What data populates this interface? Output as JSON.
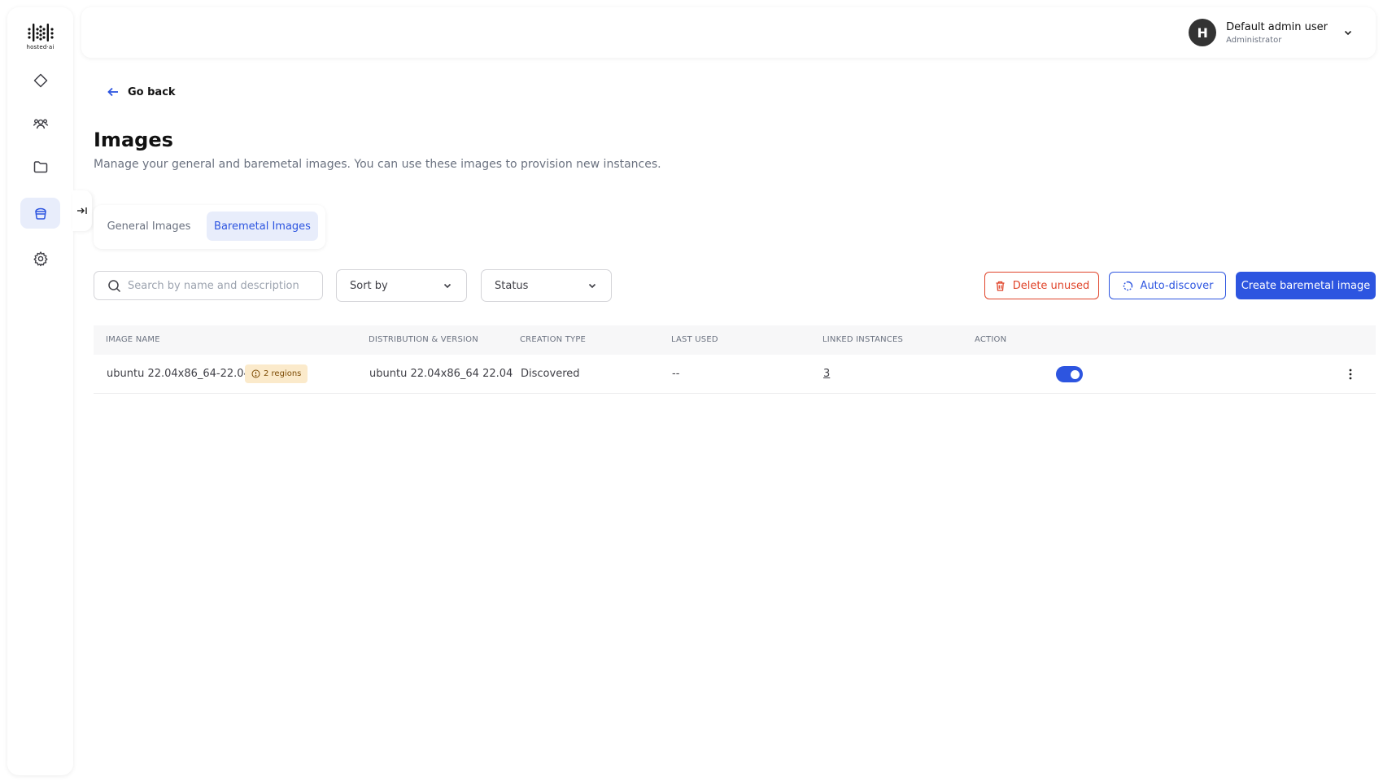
{
  "app": {
    "logo_text": "hosted·ai"
  },
  "sidebar": {
    "items": [
      {
        "icon": "diamond-icon"
      },
      {
        "icon": "team-icon"
      },
      {
        "icon": "folder-icon"
      },
      {
        "icon": "images-icon",
        "active": true
      },
      {
        "icon": "gear-icon"
      }
    ],
    "collapse_icon": "collapse-arrow-icon"
  },
  "header": {
    "user": {
      "initial": "H",
      "name": "Default admin user",
      "role": "Administrator"
    }
  },
  "page": {
    "go_back": "Go back",
    "title": "Images",
    "subtitle": "Manage your general and baremetal images. You can use these images to provision new instances."
  },
  "tabs": [
    {
      "label": "General Images",
      "active": false
    },
    {
      "label": "Baremetal Images",
      "active": true
    }
  ],
  "filters": {
    "search_placeholder": "Search by name and description",
    "sort_label": "Sort by",
    "status_label": "Status"
  },
  "actions": {
    "delete_unused": "Delete unused",
    "auto_discover": "Auto-discover",
    "create": "Create baremetal image"
  },
  "table": {
    "columns": [
      "Image name",
      "Distribution & version",
      "Creation type",
      "Last used",
      "Linked instances",
      "Action"
    ],
    "rows": [
      {
        "image_name": "ubuntu 22.04x86_64-22.04",
        "regions_badge": "2 regions",
        "distribution": "ubuntu 22.04x86_64 22.04",
        "creation_type": "Discovered",
        "last_used": "--",
        "linked_instances": "3",
        "enabled": true
      }
    ]
  },
  "colors": {
    "accent": "#2d55e0",
    "danger": "#e0442a",
    "badge_bg": "#fbeacb",
    "tab_active_bg": "#e8edfb"
  }
}
